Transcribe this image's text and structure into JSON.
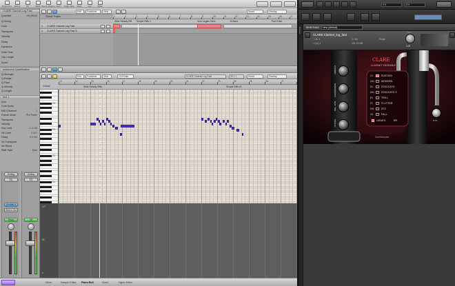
{
  "logic": {
    "toolbar": [
      {
        "label": "Preferences",
        "icon": "prefs-icon"
      },
      {
        "label": "Settings",
        "icon": "settings-icon"
      },
      {
        "label": "Mix",
        "icon": "mix-icon"
      },
      {
        "label": "Media",
        "icon": "media-icon"
      },
      {
        "label": "Bounce Regions",
        "icon": "bounce-icon"
      },
      {
        "label": "Colors",
        "icon": "colors-icon"
      },
      {
        "label": "Nudge Value",
        "icon": "nudge-icon"
      },
      {
        "label": "Notes",
        "icon": "notes-icon"
      },
      {
        "label": "Lists",
        "icon": "lists-icon"
      },
      {
        "label": "Media",
        "icon": "media2-icon"
      }
    ],
    "inspector": {
      "region_title": "CLARE Clarinet Leg Fast",
      "rows": [
        {
          "label": "Quantize",
          "value": "off (3840)"
        },
        {
          "label": "Q-Swing",
          "value": ""
        },
        {
          "label": "Loop",
          "value": ""
        },
        {
          "label": "Transpose",
          "value": ""
        },
        {
          "label": "Velocity",
          "value": ""
        },
        {
          "label": "Delay",
          "value": ""
        },
        {
          "label": "Dynamics",
          "value": ""
        },
        {
          "label": "Gate Time",
          "value": ""
        },
        {
          "label": "Clip Length",
          "value": ""
        },
        {
          "label": "Score",
          "value": ""
        }
      ],
      "section2": "Advanced Quantization",
      "rows2": [
        {
          "label": "Q-Strength",
          "value": ""
        },
        {
          "label": "Q-Range",
          "value": ""
        },
        {
          "label": "Q-Flam",
          "value": ""
        },
        {
          "label": "Q-Velocity",
          "value": ""
        },
        {
          "label": "Q-Length",
          "value": ""
        }
      ],
      "track_section": "Inst 1",
      "rows3": [
        {
          "label": "Icon",
          "value": ""
        },
        {
          "label": "Core Audio",
          "value": ""
        },
        {
          "label": "MIDI Channel",
          "value": "1"
        },
        {
          "label": "Freeze Mode",
          "value": "Pre Fader"
        },
        {
          "label": "Transpose",
          "value": ""
        },
        {
          "label": "Velocity",
          "value": ""
        },
        {
          "label": "Key Limit",
          "value": "C-2 G8"
        },
        {
          "label": "Vel Limit",
          "value": "1 127"
        },
        {
          "label": "Delay",
          "value": "0.0 ms"
        },
        {
          "label": "No Transpose",
          "value": ""
        },
        {
          "label": "No Reset",
          "value": ""
        },
        {
          "label": "Staff Style",
          "value": "Auto"
        }
      ]
    },
    "strips": [
      {
        "setting": "Setting",
        "eq": "EQ",
        "io": "Kontakt 5",
        "send": "Stereo Out",
        "read": "Read",
        "name": "Inst 1",
        "fader": 0.72
      },
      {
        "setting": "Setting",
        "eq": "EQ",
        "io": "",
        "send": "",
        "read": "Off",
        "name": "Stereo Out",
        "fader": 0.72
      }
    ],
    "arrange": {
      "edit_menu": "Edit",
      "functions_menu": "Functions",
      "view_menu": "View",
      "snap": "Smart",
      "drag": "Overlap",
      "global_tracks": "Global Tracks",
      "ruler": [
        "1",
        "2",
        "3",
        "4",
        "5",
        "6",
        "7",
        "8",
        "9",
        "10",
        "11",
        "12",
        "13",
        "14",
        "15",
        "16",
        "17"
      ],
      "markers": [
        "Wide Steady Riff",
        "Simple Riffs 1",
        "Your Legato Here",
        "B Band",
        "Part 9 Bar"
      ],
      "tracks": [
        {
          "number": "1",
          "name": "CLARE Clarinet Leg Fast"
        },
        {
          "number": "2",
          "name": "CLARE Clarinet Leg Fast B"
        }
      ]
    },
    "editor": {
      "edit_menu": "Edit",
      "functions_menu": "Functions",
      "view_menu": "View",
      "quantize": "1/16 Note",
      "region": "CLARE Clarinet Leg Fast",
      "position": "33 1 1",
      "snap": "Smart",
      "drag": "Overlap",
      "track_label": "Global",
      "ruler": [
        "13",
        "14",
        "15",
        "16",
        "17",
        "18",
        "19",
        "20",
        "21",
        "22",
        "23",
        "24",
        "25",
        "26",
        "27",
        "28"
      ],
      "markers": [
        "Wide Steady Riffs",
        "Simple Riffs #1"
      ],
      "octaves": [
        "C4",
        "C3",
        "C2",
        "C1"
      ],
      "velocity_labels": [
        "127",
        "64",
        "0"
      ]
    },
    "status_tabs": [
      "Mixer",
      "Sample Editor",
      "Piano Roll",
      "Score",
      "Hyper Editor"
    ]
  },
  "kontakt": {
    "title": "Multi Rack",
    "rack_name": "New (default)",
    "browser_label": "Browse",
    "instrument_name": "CLARE Clarinet_leg_fast",
    "output": "st. 1",
    "midi_ch": "[A] 1",
    "voices": "0",
    "max_voices": "64",
    "memory": "101.19 MB",
    "purge": "Purge",
    "tune_label": "Tune",
    "tune_value": "0.00",
    "cpu": "0%",
    "disk": "0%",
    "brand": "CLARE",
    "subtitle": "CLARINET ENSEMBLE",
    "articulations": [
      {
        "key": "C1",
        "label": "SUSTAIN",
        "on": true
      },
      {
        "key": "C#1",
        "label": "MODERN",
        "on": false
      },
      {
        "key": "D1",
        "label": "STACCATO",
        "on": false
      },
      {
        "key": "D#1",
        "label": "STACCATO 2",
        "on": false
      },
      {
        "key": "E1",
        "label": "TRILL",
        "on": false
      },
      {
        "key": "F1",
        "label": "FLUTTER",
        "on": false
      },
      {
        "key": "F#1",
        "label": "SFZ",
        "on": false
      },
      {
        "key": "G1",
        "label": "FALL",
        "on": false
      }
    ],
    "pad_labels": [
      "VIBRATO",
      "EXPRESSION",
      "REL. DYN",
      "ATTACK"
    ],
    "legato_label": "LEGATO",
    "legato_rr": "RR",
    "footer": "CineSamples",
    "dyn_label": "DYN"
  },
  "colors": {
    "note": "#4d39c9",
    "region_selected": "#f17e93",
    "kontakt_accent": "#ff4a4a"
  },
  "notes": [
    {
      "bar": 13.0,
      "pitch": 28,
      "len": 0.12
    },
    {
      "bar": 15.0,
      "pitch": 29,
      "len": 0.35
    },
    {
      "bar": 15.4,
      "pitch": 31,
      "len": 0.08
    },
    {
      "bar": 15.5,
      "pitch": 30,
      "len": 0.05
    },
    {
      "bar": 15.6,
      "pitch": 29,
      "len": 0.08
    },
    {
      "bar": 15.75,
      "pitch": 30,
      "len": 0.06
    },
    {
      "bar": 15.85,
      "pitch": 29,
      "len": 0.08
    },
    {
      "bar": 16.0,
      "pitch": 31,
      "len": 0.12
    },
    {
      "bar": 16.15,
      "pitch": 30,
      "len": 0.08
    },
    {
      "bar": 16.25,
      "pitch": 29,
      "len": 0.07
    },
    {
      "bar": 16.4,
      "pitch": 28,
      "len": 0.1
    },
    {
      "bar": 16.55,
      "pitch": 27,
      "len": 0.2
    },
    {
      "bar": 16.9,
      "pitch": 28,
      "len": 0.9
    },
    {
      "bar": 16.85,
      "pitch": 24,
      "len": 0.15
    },
    {
      "bar": 22.0,
      "pitch": 31,
      "len": 0.12
    },
    {
      "bar": 22.2,
      "pitch": 30,
      "len": 0.15
    },
    {
      "bar": 22.4,
      "pitch": 31,
      "len": 0.1
    },
    {
      "bar": 22.55,
      "pitch": 30,
      "len": 0.08
    },
    {
      "bar": 22.65,
      "pitch": 29,
      "len": 0.08
    },
    {
      "bar": 22.8,
      "pitch": 30,
      "len": 0.08
    },
    {
      "bar": 22.9,
      "pitch": 31,
      "len": 0.1
    },
    {
      "bar": 23.05,
      "pitch": 30,
      "len": 0.06
    },
    {
      "bar": 23.15,
      "pitch": 29,
      "len": 0.12
    },
    {
      "bar": 23.35,
      "pitch": 30,
      "len": 0.08
    },
    {
      "bar": 23.5,
      "pitch": 29,
      "len": 0.1
    },
    {
      "bar": 23.62,
      "pitch": 30,
      "len": 0.08
    },
    {
      "bar": 23.8,
      "pitch": 28,
      "len": 0.1
    },
    {
      "bar": 23.92,
      "pitch": 27,
      "len": 0.15
    },
    {
      "bar": 24.2,
      "pitch": 26,
      "len": 0.2
    },
    {
      "bar": 24.55,
      "pitch": 24,
      "len": 0.1
    }
  ]
}
